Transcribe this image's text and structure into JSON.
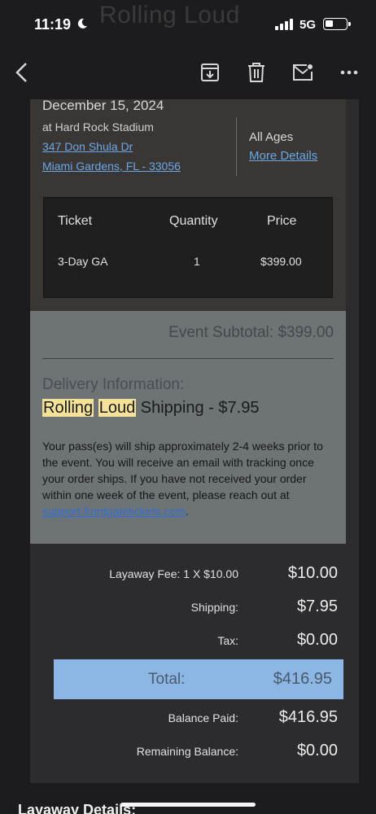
{
  "status_bar": {
    "time": "11:19",
    "network": "5G"
  },
  "email": {
    "subject_partial": "Rolling Loud"
  },
  "toolbar": {
    "back_icon": "chevron-left-icon",
    "archive_icon": "archive-icon",
    "trash_icon": "trash-icon",
    "mail_icon": "mail-icon",
    "more_icon": "more-icon"
  },
  "event": {
    "date": "December 15, 2024",
    "venue": "at Hard Rock Stadium",
    "address_line1": "347 Don Shula Dr",
    "address_line2": "Miami Gardens, FL - 33056",
    "age": "All Ages",
    "more_details": "More Details"
  },
  "ticket_table": {
    "headers": [
      "Ticket",
      "Quantity",
      "Price"
    ],
    "rows": [
      {
        "ticket": "3-Day GA",
        "quantity": "1",
        "price": "$399.00"
      }
    ]
  },
  "delivery": {
    "subtotal": "Event Subtotal: $399.00",
    "label": "Delivery Information:",
    "ship_word1": "Rolling",
    "ship_word2": "Loud",
    "ship_rest": " Shipping - $7.95",
    "text_before": "Your pass(es) will ship approximately 2-4 weeks prior to the event. You will receive an email with tracking once your order ships. If you have not received your order within one week of the event, please reach out at ",
    "link": "support.frontgatetickets.com",
    "text_after": "."
  },
  "summary": {
    "layaway_label": "Layaway Fee: 1 X $10.00",
    "layaway_value": "$10.00",
    "shipping_label": "Shipping:",
    "shipping_value": "$7.95",
    "tax_label": "Tax:",
    "tax_value": "$0.00",
    "total_label": "Total:",
    "total_value": "$416.95",
    "paid_label": "Balance Paid:",
    "paid_value": "$416.95",
    "remaining_label": "Remaining Balance:",
    "remaining_value": "$0.00"
  },
  "footer": {
    "heading": "Layaway Details:"
  },
  "colors": {
    "link": "#6aa7e8",
    "highlight": "#f5e29a",
    "total_bar": "#8cb6e4",
    "delivery_bg": "#6e7376"
  }
}
